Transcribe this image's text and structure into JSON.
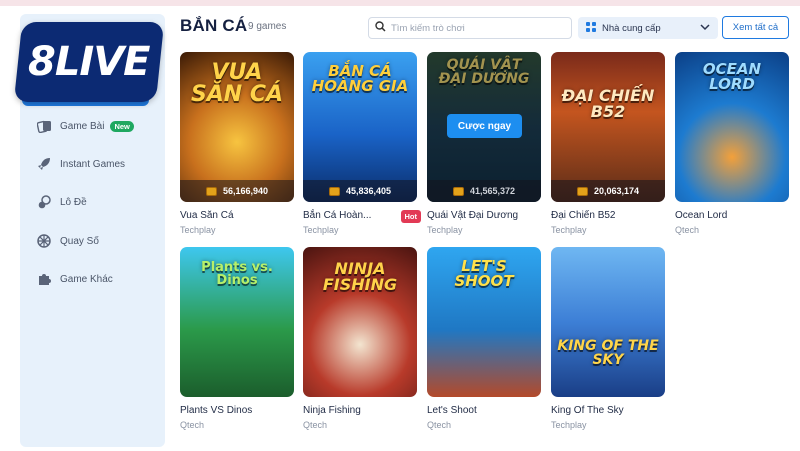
{
  "brand": {
    "logo_text": "8LIVE"
  },
  "sidebar": {
    "items": [
      {
        "label": "Game Bài",
        "icon": "cards-icon",
        "badge": "New"
      },
      {
        "label": "Instant Games",
        "icon": "rocket-icon"
      },
      {
        "label": "Lô Đề",
        "icon": "lottery-balls-icon"
      },
      {
        "label": "Quay Số",
        "icon": "wheel-icon"
      },
      {
        "label": "Game Khác",
        "icon": "puzzle-icon"
      }
    ]
  },
  "header": {
    "title": "BẮN CÁ",
    "count": "9 games",
    "search_placeholder": "Tìm kiếm trò chơi",
    "provider_label": "Nhà cung cấp",
    "see_all": "Xem tất cả"
  },
  "games": [
    {
      "name": "Vua Săn Cá",
      "provider": "Techplay",
      "jackpot": "56,166,940",
      "art": "VUA SĂN CÁ"
    },
    {
      "name": "Bắn Cá Hoàn...",
      "provider": "Techplay",
      "jackpot": "45,836,405",
      "art": "BẮN CÁ HOÀNG GIA",
      "badge": "Hot"
    },
    {
      "name": "Quái Vật Đại Dương",
      "provider": "Techplay",
      "jackpot": "41,565,372",
      "art": "QUÁI VẬT ĐẠI DƯƠNG",
      "hover_button": "Cược ngay"
    },
    {
      "name": "Đại Chiến B52",
      "provider": "Techplay",
      "jackpot": "20,063,174",
      "art": "ĐẠI CHIẾN B52"
    },
    {
      "name": "Ocean Lord",
      "provider": "Qtech",
      "art": "OCEAN LORD"
    },
    {
      "name": "Plants VS Dinos",
      "provider": "Qtech",
      "art": "Plants vs. Dinos"
    },
    {
      "name": "Ninja Fishing",
      "provider": "Qtech",
      "art": "NINJA FISHING"
    },
    {
      "name": "Let's Shoot",
      "provider": "Qtech",
      "art": "LET'S SHOOT"
    },
    {
      "name": "King Of The Sky",
      "provider": "Techplay",
      "art": "KING OF THE SKY"
    }
  ],
  "colors": {
    "accent": "#1f7ae0",
    "hot": "#e23a55",
    "new": "#1fa860",
    "sidebar_bg": "#e7f1fb"
  }
}
